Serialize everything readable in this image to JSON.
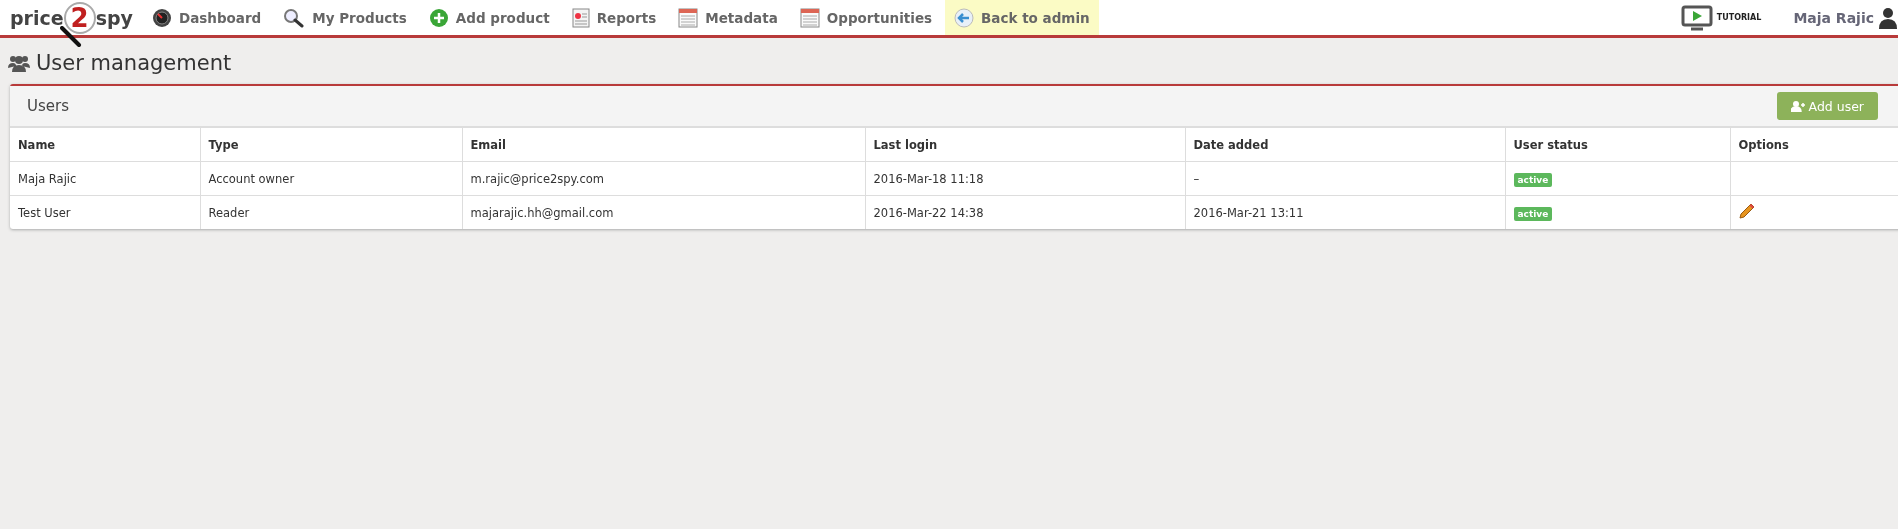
{
  "logo": {
    "before": "price",
    "mark": "2",
    "after": "spy"
  },
  "nav": [
    {
      "label": "Dashboard",
      "kind": "gauge",
      "highlighted": false
    },
    {
      "label": "My Products",
      "kind": "search",
      "highlighted": false
    },
    {
      "label": "Add product",
      "kind": "plus",
      "highlighted": false
    },
    {
      "label": "Reports",
      "kind": "report",
      "highlighted": false
    },
    {
      "label": "Metadata",
      "kind": "sheet",
      "highlighted": false
    },
    {
      "label": "Opportunities",
      "kind": "sheet",
      "highlighted": false
    },
    {
      "label": "Back to admin",
      "kind": "back",
      "highlighted": true
    }
  ],
  "tutorial": "TUTORIAL",
  "user_name": "Maja Rajic",
  "page_title": "User management",
  "panel": {
    "title": "Users",
    "add_button": "Add user",
    "columns": [
      "Name",
      "Type",
      "Email",
      "Last login",
      "Date added",
      "User status",
      "Options"
    ],
    "rows": [
      {
        "name": "Maja Rajic",
        "type": "Account owner",
        "email": "m.rajic@price2spy.com",
        "last_login": "2016-Mar-18 11:18",
        "date_added": "–",
        "status": "active",
        "editable": false
      },
      {
        "name": "Test User",
        "type": "Reader",
        "email": "majarajic.hh@gmail.com",
        "last_login": "2016-Mar-22 14:38",
        "date_added": "2016-Mar-21 13:11",
        "status": "active",
        "editable": true
      }
    ]
  }
}
